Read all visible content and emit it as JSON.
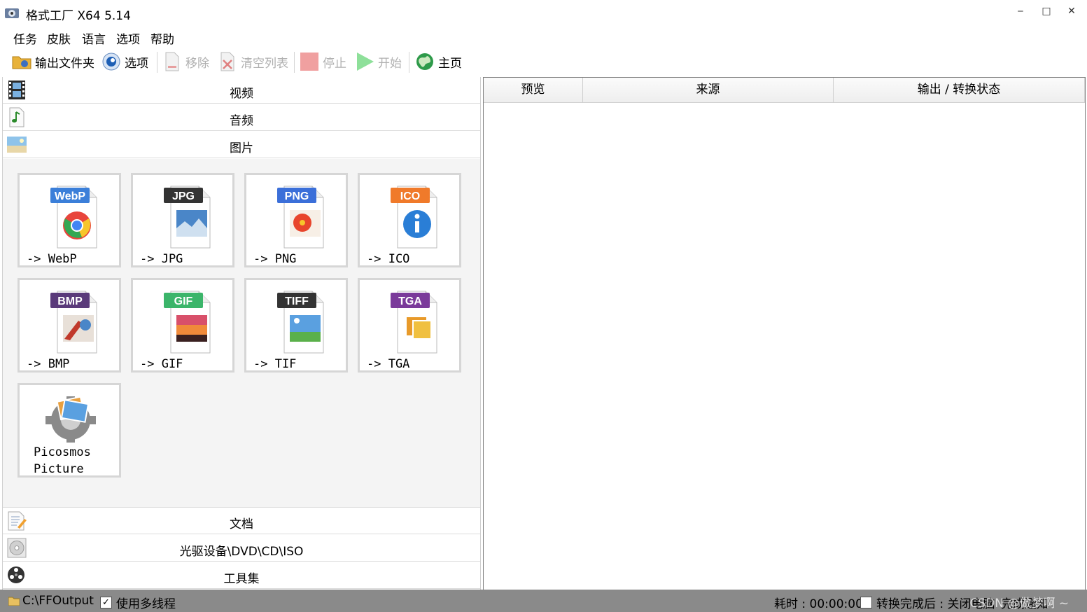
{
  "window": {
    "title": "格式工厂 X64 5.14",
    "minimize": "‒",
    "maximize": "□",
    "close": "✕"
  },
  "menu": [
    "任务",
    "皮肤",
    "语言",
    "选项",
    "帮助"
  ],
  "toolbar": {
    "output_folder": "输出文件夹",
    "options": "选项",
    "remove": "移除",
    "clear_list": "清空列表",
    "stop": "停止",
    "start": "开始",
    "home": "主页"
  },
  "categories": {
    "video": "视频",
    "audio": "音频",
    "image": "图片",
    "document": "文档",
    "optical": "光驱设备\\DVD\\CD\\ISO",
    "tools": "工具集"
  },
  "formats": [
    {
      "tag": "WebP",
      "caption": "-> WebP",
      "tag_color": "#3b7fd9"
    },
    {
      "tag": "JPG",
      "caption": "-> JPG",
      "tag_color": "#333333"
    },
    {
      "tag": "PNG",
      "caption": "-> PNG",
      "tag_color": "#3b6fd9"
    },
    {
      "tag": "ICO",
      "caption": "-> ICO",
      "tag_color": "#f07a2a"
    },
    {
      "tag": "BMP",
      "caption": "-> BMP",
      "tag_color": "#5a3a7a"
    },
    {
      "tag": "GIF",
      "caption": "-> GIF",
      "tag_color": "#3bb56a"
    },
    {
      "tag": "TIFF",
      "caption": "-> TIF",
      "tag_color": "#333333"
    },
    {
      "tag": "TGA",
      "caption": "-> TGA",
      "tag_color": "#7a3a9a"
    }
  ],
  "picosmos": {
    "line1": "Picosmos",
    "line2": "Picture"
  },
  "table": {
    "columns": [
      "预览",
      "来源",
      "输出 / 转换状态"
    ]
  },
  "status": {
    "output_path": "C:\\FFOutput",
    "multithread_label": "使用多线程",
    "multithread_checked": true,
    "elapsed": "耗时 : 00:00:00",
    "after_label": "转换完成后 : 关闭电脑",
    "after_checked": false,
    "notify": "完成通知",
    "watermark": "CSDN @做梦啊 ~"
  },
  "colors": {
    "statusbar": "#8a8a8a",
    "tile_border": "#d6d6d6"
  }
}
